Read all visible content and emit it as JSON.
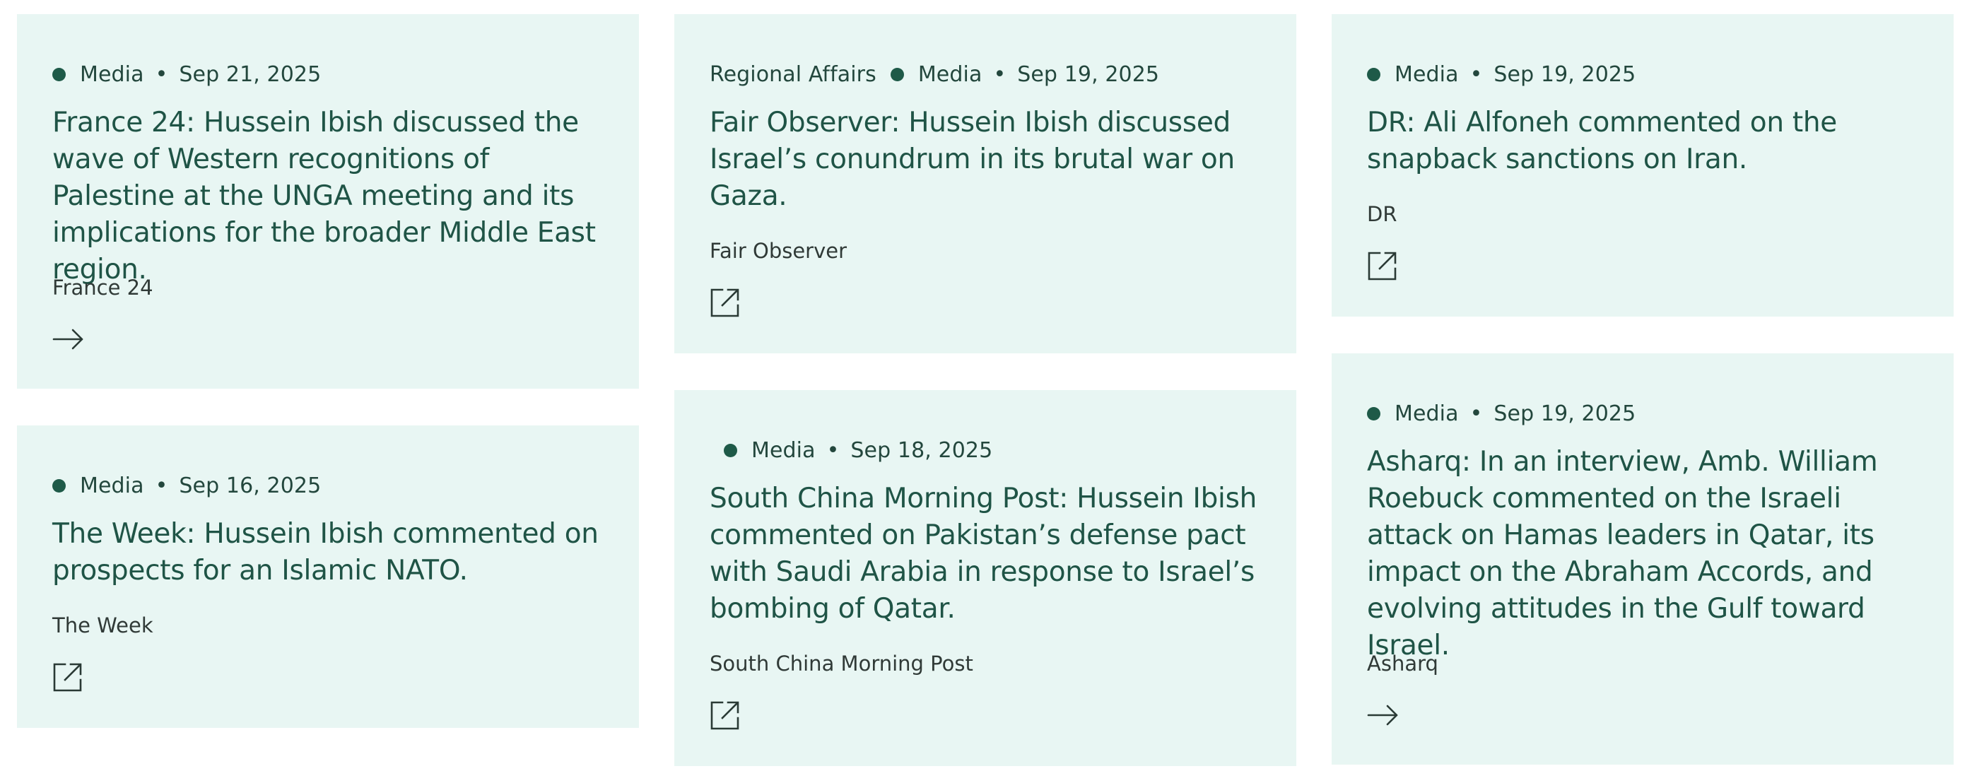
{
  "cards": [
    {
      "region": "",
      "category": "Media",
      "date": "Sep 21, 2025",
      "title": "France 24: Hussein Ibish discussed the wave of Western recognitions of Palestine at the UNGA meeting and its implications for the broader Middle East region.",
      "source": "France 24",
      "icon": "arrow-right-icon"
    },
    {
      "region": "Regional Affairs",
      "category": "Media",
      "date": "Sep 19, 2025",
      "title": "Fair Observer: Hussein Ibish discussed Israel’s conundrum in its brutal war on Gaza.",
      "source": "Fair Observer",
      "icon": "external-link-icon"
    },
    {
      "region": "",
      "category": "Media",
      "date": "Sep 19, 2025",
      "title": "DR: Ali Alfoneh commented on the snapback sanctions on Iran.",
      "source": "DR",
      "icon": "external-link-icon"
    },
    {
      "region": "",
      "category": "Media",
      "date": "Sep 16, 2025",
      "title": "The Week: Hussein Ibish commented on prospects for an Islamic NATO.",
      "source": "The Week",
      "icon": "external-link-icon"
    },
    {
      "region": "",
      "category": "Media",
      "date": "Sep 18, 2025",
      "title": "South China Morning Post: Hussein Ibish commented on Pakistan’s defense pact with Saudi Arabia in response to Israel’s bombing of Qatar.",
      "source": "South China Morning Post",
      "icon": "external-link-icon"
    },
    {
      "region": "",
      "category": "Media",
      "date": "Sep 19, 2025",
      "title": "Asharq: In an interview, Amb. William Roebuck commented on the Israeli attack on Hamas leaders in Qatar, its impact on the Abraham Accords, and evolving attitudes in the Gulf toward Israel.",
      "source": "Asharq",
      "icon": "arrow-right-icon"
    }
  ],
  "colors": {
    "card_background": "#e8f6f3",
    "title_text": "#1f5446",
    "dot": "#1e5a48"
  }
}
